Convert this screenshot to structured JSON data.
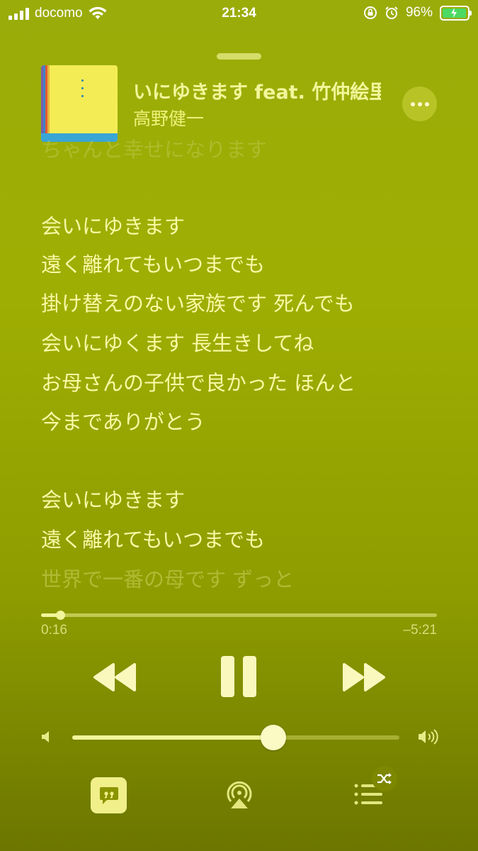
{
  "status_bar": {
    "carrier": "docomo",
    "time": "21:34",
    "battery_percent": "96%",
    "battery_level": 0.96,
    "icons": [
      "signal-icon",
      "wifi-icon",
      "orientation-lock-icon",
      "alarm-icon",
      "battery-charging-icon"
    ]
  },
  "now_playing": {
    "title": "いにゆきます feat. 竹仲絵里",
    "artist": "高野健一",
    "album_art": "album-art"
  },
  "lyrics": {
    "lines": [
      "ちゃんと幸せになります",
      "",
      "会いにゆきます",
      "遠く離れてもいつまでも",
      "掛け替えのない家族です 死んでも",
      "会いにゆくます 長生きしてね",
      "お母さんの子供で良かった ほんと",
      "今までありがとう",
      "",
      "会いにゆきます",
      "遠く離れてもいつまでも",
      "世界で一番の母です ずっと"
    ]
  },
  "playback": {
    "elapsed": "0:16",
    "remaining": "–5:21",
    "progress": 0.048,
    "state": "playing"
  },
  "volume": {
    "level": 0.615
  },
  "colors": {
    "background": "#9fae02",
    "accent": "#f2f59a",
    "text": "#faf8a6"
  }
}
